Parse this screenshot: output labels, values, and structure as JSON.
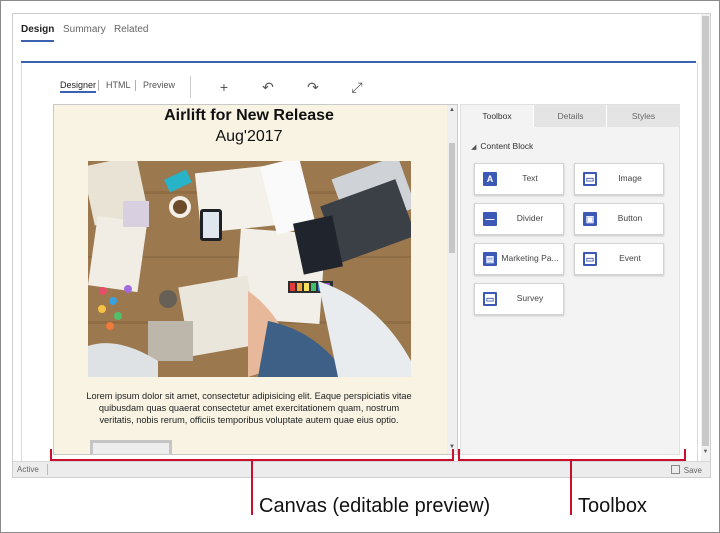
{
  "top_tabs": {
    "design": "Design",
    "summary": "Summary",
    "related": "Related"
  },
  "editor_tabs": {
    "designer": "Designer",
    "html": "HTML",
    "preview": "Preview"
  },
  "toolbar": {
    "add_glyph": "+",
    "undo_glyph": "↶",
    "redo_glyph": "↷",
    "expand_glyph": "⤢"
  },
  "canvas": {
    "title": "Airlift for New Release",
    "subtitle": "Aug'2017",
    "body_text": "Lorem ipsum dolor sit amet, consectetur adipisicing elit. Eaque perspiciatis vitae quibusdam quas quaerat consectetur amet exercitationem quam, nostrum veritatis, nobis rerum, officiis temporibus voluptate autem quae eius optio."
  },
  "panel": {
    "tabs": {
      "toolbox": "Toolbox",
      "details": "Details",
      "styles": "Styles"
    },
    "section_title": "Content Block",
    "blocks": [
      {
        "label": "Text",
        "icon": "text-icon",
        "glyph": "A"
      },
      {
        "label": "Image",
        "icon": "image-icon",
        "glyph": "▭"
      },
      {
        "label": "Divider",
        "icon": "divider-icon",
        "glyph": "—"
      },
      {
        "label": "Button",
        "icon": "button-icon",
        "glyph": "▣"
      },
      {
        "label": "Marketing Pa...",
        "icon": "marketing-page-icon",
        "glyph": "▤"
      },
      {
        "label": "Event",
        "icon": "event-icon",
        "glyph": "▭"
      },
      {
        "label": "Survey",
        "icon": "survey-icon",
        "glyph": "▭"
      }
    ]
  },
  "status": {
    "state": "Active",
    "save": "Save"
  },
  "annotations": {
    "canvas": "Canvas (editable preview)",
    "toolbox": "Toolbox"
  },
  "colors": {
    "accent": "#3a62b0",
    "icon_blue": "#3c5ab5",
    "brace_red": "#c8102e",
    "canvas_bg": "#f8f3e3"
  }
}
